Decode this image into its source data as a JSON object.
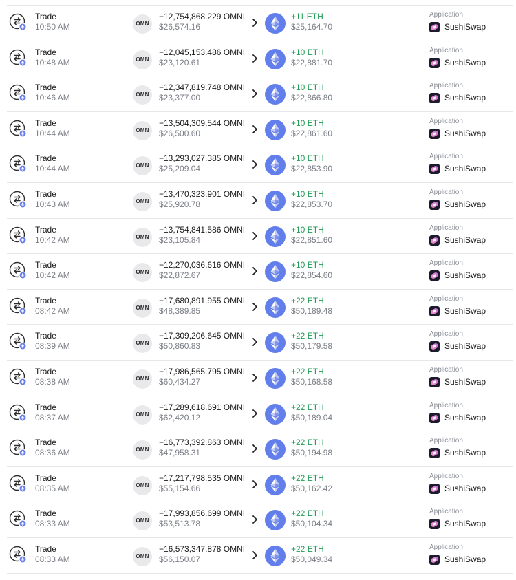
{
  "trades": [
    {
      "type": "Trade",
      "time": "10:50 AM",
      "token_badge": "OMN",
      "amount": "−12,754,868.229 OMNI",
      "usd": "$26,574.16",
      "eth": "+11 ETH",
      "eth_usd": "$25,164.70",
      "app_label": "Application",
      "app": "SushiSwap"
    },
    {
      "type": "Trade",
      "time": "10:48 AM",
      "token_badge": "OMN",
      "amount": "−12,045,153.486 OMNI",
      "usd": "$23,120.61",
      "eth": "+10 ETH",
      "eth_usd": "$22,881.70",
      "app_label": "Application",
      "app": "SushiSwap"
    },
    {
      "type": "Trade",
      "time": "10:46 AM",
      "token_badge": "OMN",
      "amount": "−12,347,819.748 OMNI",
      "usd": "$23,377.00",
      "eth": "+10 ETH",
      "eth_usd": "$22,866.80",
      "app_label": "Application",
      "app": "SushiSwap"
    },
    {
      "type": "Trade",
      "time": "10:44 AM",
      "token_badge": "OMN",
      "amount": "−13,504,309.544 OMNI",
      "usd": "$26,500.60",
      "eth": "+10 ETH",
      "eth_usd": "$22,861.60",
      "app_label": "Application",
      "app": "SushiSwap"
    },
    {
      "type": "Trade",
      "time": "10:44 AM",
      "token_badge": "OMN",
      "amount": "−13,293,027.385 OMNI",
      "usd": "$25,209.04",
      "eth": "+10 ETH",
      "eth_usd": "$22,853.90",
      "app_label": "Application",
      "app": "SushiSwap"
    },
    {
      "type": "Trade",
      "time": "10:43 AM",
      "token_badge": "OMN",
      "amount": "−13,470,323.901 OMNI",
      "usd": "$25,920.78",
      "eth": "+10 ETH",
      "eth_usd": "$22,853.70",
      "app_label": "Application",
      "app": "SushiSwap"
    },
    {
      "type": "Trade",
      "time": "10:42 AM",
      "token_badge": "OMN",
      "amount": "−13,754,841.586 OMNI",
      "usd": "$23,105.84",
      "eth": "+10 ETH",
      "eth_usd": "$22,851.60",
      "app_label": "Application",
      "app": "SushiSwap"
    },
    {
      "type": "Trade",
      "time": "10:42 AM",
      "token_badge": "OMN",
      "amount": "−12,270,036.616 OMNI",
      "usd": "$22,872.67",
      "eth": "+10 ETH",
      "eth_usd": "$22,854.60",
      "app_label": "Application",
      "app": "SushiSwap"
    },
    {
      "type": "Trade",
      "time": "08:42 AM",
      "token_badge": "OMN",
      "amount": "−17,680,891.955 OMNI",
      "usd": "$48,389.85",
      "eth": "+22 ETH",
      "eth_usd": "$50,189.48",
      "app_label": "Application",
      "app": "SushiSwap"
    },
    {
      "type": "Trade",
      "time": "08:39 AM",
      "token_badge": "OMN",
      "amount": "−17,309,206.645 OMNI",
      "usd": "$50,860.83",
      "eth": "+22 ETH",
      "eth_usd": "$50,179.58",
      "app_label": "Application",
      "app": "SushiSwap"
    },
    {
      "type": "Trade",
      "time": "08:38 AM",
      "token_badge": "OMN",
      "amount": "−17,986,565.795 OMNI",
      "usd": "$60,434.27",
      "eth": "+22 ETH",
      "eth_usd": "$50,168.58",
      "app_label": "Application",
      "app": "SushiSwap"
    },
    {
      "type": "Trade",
      "time": "08:37 AM",
      "token_badge": "OMN",
      "amount": "−17,289,618.691 OMNI",
      "usd": "$62,420.12",
      "eth": "+22 ETH",
      "eth_usd": "$50,189.04",
      "app_label": "Application",
      "app": "SushiSwap"
    },
    {
      "type": "Trade",
      "time": "08:36 AM",
      "token_badge": "OMN",
      "amount": "−16,773,392.863 OMNI",
      "usd": "$47,958.31",
      "eth": "+22 ETH",
      "eth_usd": "$50,194.98",
      "app_label": "Application",
      "app": "SushiSwap"
    },
    {
      "type": "Trade",
      "time": "08:35 AM",
      "token_badge": "OMN",
      "amount": "−17,217,798.535 OMNI",
      "usd": "$55,154.66",
      "eth": "+22 ETH",
      "eth_usd": "$50,162.42",
      "app_label": "Application",
      "app": "SushiSwap"
    },
    {
      "type": "Trade",
      "time": "08:33 AM",
      "token_badge": "OMN",
      "amount": "−17,993,856.699 OMNI",
      "usd": "$53,513.78",
      "eth": "+22 ETH",
      "eth_usd": "$50,104.34",
      "app_label": "Application",
      "app": "SushiSwap"
    },
    {
      "type": "Trade",
      "time": "08:33 AM",
      "token_badge": "OMN",
      "amount": "−16,573,347.878 OMNI",
      "usd": "$56,150.07",
      "eth": "+22 ETH",
      "eth_usd": "$50,049.34",
      "app_label": "Application",
      "app": "SushiSwap"
    }
  ]
}
